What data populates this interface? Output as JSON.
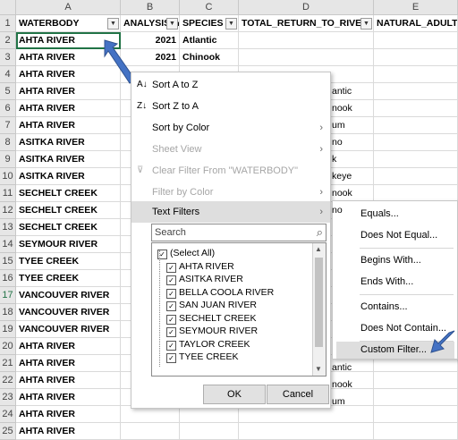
{
  "columns": [
    "A",
    "B",
    "C",
    "D",
    "E"
  ],
  "header_row": {
    "num": "1",
    "waterbody": "WATERBODY",
    "analysis": "ANALYSIS_Y",
    "species": "SPECIES",
    "total_return": "TOTAL_RETURN_TO_RIVE",
    "natural_adult": "NATURAL_ADULT"
  },
  "rows": [
    {
      "num": "2",
      "a": "AHTA RIVER",
      "b": "2021",
      "c": "Atlantic"
    },
    {
      "num": "3",
      "a": "AHTA RIVER",
      "b": "2021",
      "c": "Chinook"
    },
    {
      "num": "4",
      "a": "AHTA RIVER",
      "b": "",
      "c": ""
    },
    {
      "num": "5",
      "a": "AHTA RIVER",
      "b": "",
      "c": ""
    },
    {
      "num": "6",
      "a": "AHTA RIVER",
      "b": "",
      "c": ""
    },
    {
      "num": "7",
      "a": "AHTA RIVER",
      "b": "",
      "c": ""
    },
    {
      "num": "8",
      "a": "ASITKA RIVER",
      "b": "",
      "c": ""
    },
    {
      "num": "9",
      "a": "ASITKA RIVER",
      "b": "",
      "c": ""
    },
    {
      "num": "10",
      "a": "ASITKA RIVER",
      "b": "",
      "c": ""
    },
    {
      "num": "11",
      "a": "SECHELT CREEK",
      "b": "",
      "c": ""
    },
    {
      "num": "12",
      "a": "SECHELT CREEK",
      "b": "",
      "c": ""
    },
    {
      "num": "13",
      "a": "SECHELT CREEK",
      "b": "",
      "c": ""
    },
    {
      "num": "14",
      "a": "SEYMOUR RIVER",
      "b": "",
      "c": ""
    },
    {
      "num": "15",
      "a": "TYEE CREEK",
      "b": "",
      "c": ""
    },
    {
      "num": "16",
      "a": "TYEE CREEK",
      "b": "",
      "c": ""
    },
    {
      "num": "17",
      "a": "VANCOUVER RIVER",
      "b": "",
      "c": ""
    },
    {
      "num": "18",
      "a": "VANCOUVER RIVER",
      "b": "",
      "c": ""
    },
    {
      "num": "19",
      "a": "VANCOUVER RIVER",
      "b": "",
      "c": ""
    },
    {
      "num": "20",
      "a": "AHTA RIVER",
      "b": "",
      "c": ""
    },
    {
      "num": "21",
      "a": "AHTA RIVER",
      "b": "",
      "c": ""
    },
    {
      "num": "22",
      "a": "AHTA RIVER",
      "b": "",
      "c": ""
    },
    {
      "num": "23",
      "a": "AHTA RIVER",
      "b": "",
      "c": ""
    },
    {
      "num": "24",
      "a": "AHTA RIVER",
      "b": "",
      "c": ""
    },
    {
      "num": "25",
      "a": "AHTA RIVER",
      "b": "",
      "c": ""
    }
  ],
  "behind_menu_c": [
    "antic",
    "nook",
    "um",
    "no",
    "k",
    "keye",
    "nook",
    "no"
  ],
  "behind_menu_c_bottom": [
    "antic",
    "nook",
    "um"
  ],
  "filter_menu": {
    "sort_az": "Sort A to Z",
    "sort_za": "Sort Z to A",
    "sort_by_color": "Sort by Color",
    "sheet_view": "Sheet View",
    "clear_filter": "Clear Filter From \"WATERBODY\"",
    "filter_by_color": "Filter by Color",
    "text_filters": "Text Filters",
    "search_placeholder": "Search",
    "items": [
      "(Select All)",
      "AHTA RIVER",
      "ASITKA RIVER",
      "BELLA COOLA RIVER",
      "SAN JUAN RIVER",
      "SECHELT CREEK",
      "SEYMOUR RIVER",
      "TAYLOR CREEK",
      "TYEE CREEK"
    ],
    "ok": "OK",
    "cancel": "Cancel"
  },
  "text_filters_submenu": {
    "equals": "Equals...",
    "not_equal": "Does Not Equal...",
    "begins_with": "Begins With...",
    "ends_with": "Ends With...",
    "contains": "Contains...",
    "not_contain": "Does Not Contain...",
    "custom": "Custom Filter..."
  },
  "accent_color": "#4472c4"
}
